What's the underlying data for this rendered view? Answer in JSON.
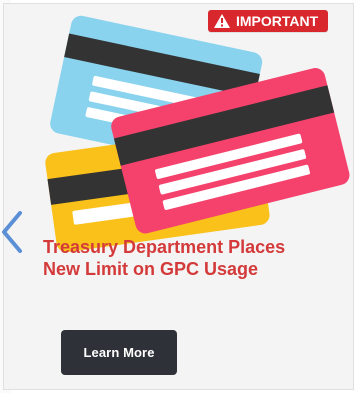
{
  "badge": {
    "label": "IMPORTANT",
    "icon": "warning-triangle-icon",
    "color": "#d8282e"
  },
  "headline": {
    "line1": "Treasury Department Places",
    "line2": "New Limit on GPC Usage",
    "color": "#d43a3a"
  },
  "cta": {
    "label": "Learn More",
    "color": "#2e3138"
  },
  "carousel": {
    "prev_icon": "chevron-left-icon",
    "accent": "#5b8fd6"
  },
  "illustration": {
    "icon": "credit-cards-icon"
  }
}
